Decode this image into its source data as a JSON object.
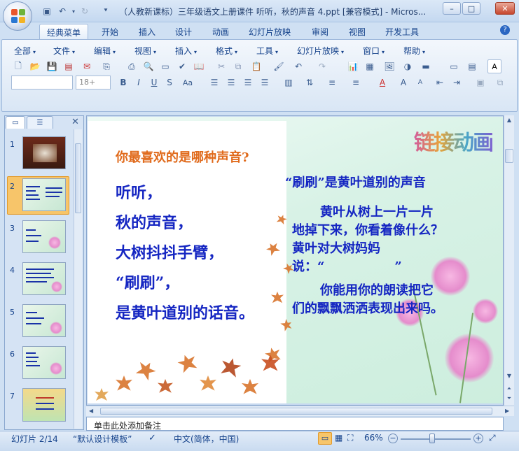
{
  "window": {
    "title": "（人教新课标）三年级语文上册课件 听听，秋的声音 4.ppt [兼容模式] - Micros...",
    "controls": {
      "minimize": "–",
      "maximize": "□",
      "close": "✕"
    }
  },
  "ribbon_tabs": [
    "经典菜单",
    "开始",
    "插入",
    "设计",
    "动画",
    "幻灯片放映",
    "审阅",
    "视图",
    "开发工具"
  ],
  "menu": [
    "全部",
    "文件",
    "编辑",
    "视图",
    "插入",
    "格式",
    "工具",
    "幻灯片放映",
    "窗口",
    "帮助"
  ],
  "font_size_placeholder": "18+",
  "slide_panel": {
    "tabs": [
      "",
      ""
    ],
    "thumbnails": [
      "1",
      "2",
      "3",
      "4",
      "5",
      "6",
      "7"
    ],
    "selected": "2"
  },
  "slide": {
    "corner_text": "链接动画",
    "question": "你最喜欢的是哪种声音?",
    "poem_lines": [
      "听听，",
      "秋的声音，",
      "大树抖抖手臂，",
      "“刷刷”，",
      "是黄叶道别的话音。"
    ],
    "right_heading": "“刷刷”是黄叶道别的声音",
    "right_para1": "黄叶从树上一片一片地掉下来，你看着像什么？黄叶对大树妈妈说：“",
    "right_para1_close": "”",
    "right_para2": "你能用你的朗读把它们的飘飘洒洒表现出来吗。"
  },
  "notes_text": "单击此处添加备注",
  "status": {
    "slide_info": "幻灯片 2/14",
    "template": "“默认设计模板”",
    "language": "中文(简体，中国)",
    "zoom": "66%",
    "zoom_level_fraction": 0.45
  },
  "colors": {
    "question": "#e06a1b",
    "body_text": "#1526c2"
  }
}
